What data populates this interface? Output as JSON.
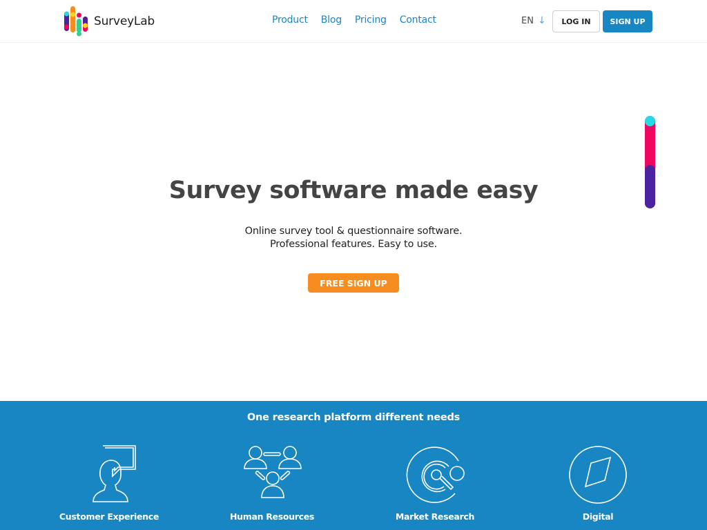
{
  "header": {
    "brand": "SurveyLab",
    "nav": [
      {
        "label": "Product"
      },
      {
        "label": "Blog"
      },
      {
        "label": "Pricing"
      },
      {
        "label": "Contact"
      }
    ],
    "language": "EN",
    "language_icon": "arrow-down-icon",
    "login_label": "LOG IN",
    "signup_label": "SIGN UP"
  },
  "hero": {
    "title": "Survey software made easy",
    "subtitle_line1": "Online survey tool & questionnaire software.",
    "subtitle_line2": "Professional features. Easy to use.",
    "cta_label": "FREE SIGN UP"
  },
  "features": {
    "title": "One research platform different needs",
    "items": [
      {
        "label": "Customer Experience",
        "icon": "customer-speech-icon"
      },
      {
        "label": "Human Resources",
        "icon": "people-network-icon"
      },
      {
        "label": "Market Research",
        "icon": "magnifier-circle-icon"
      },
      {
        "label": "Digital",
        "icon": "compass-icon"
      }
    ]
  },
  "colors": {
    "brand_blue": "#1786c3",
    "cta_orange": "#f78d1e",
    "heading_gray": "#444444",
    "accent_pink": "#ee0661",
    "accent_purple": "#4b23a0",
    "accent_cyan": "#25d9e6"
  }
}
